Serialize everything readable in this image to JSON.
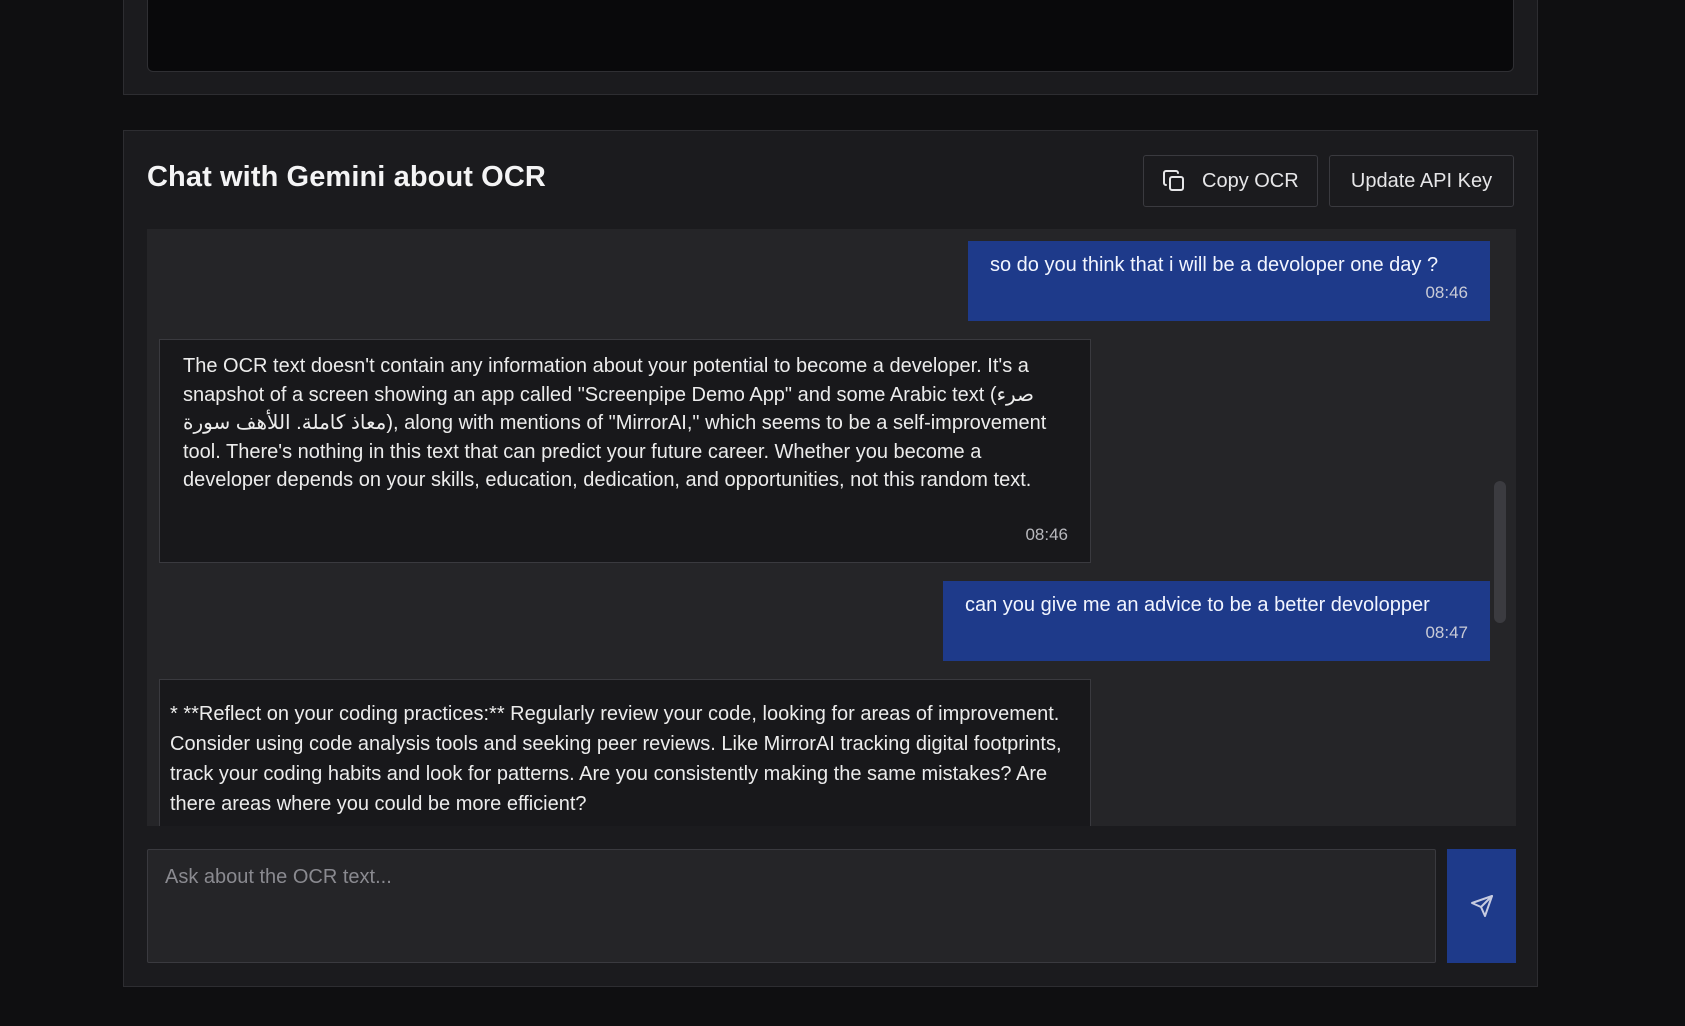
{
  "chat": {
    "title": "Chat with Gemini about OCR",
    "copy_ocr_label": "Copy OCR",
    "update_api_key_label": "Update API Key",
    "input_placeholder": "Ask about the OCR text...",
    "send_icon": "send-icon",
    "copy_icon": "copy-icon",
    "colors": {
      "user_bubble": "#1e3a8a",
      "background": "#0f0f11"
    },
    "messages": [
      {
        "role": "user",
        "text": "so do you think that i will be a devoloper one day ?",
        "time": "08:46"
      },
      {
        "role": "assistant",
        "text": "The OCR text doesn't contain any information about your potential to become a developer. It's a snapshot of a screen showing an app called \"Screenpipe Demo App\" and some Arabic text (صرء معاذ كاملة. اللأهف سورة), along with mentions of \"MirrorAI,\" which seems to be a self-improvement tool.  There's nothing in this text that can predict your future career.  Whether you become a developer depends on your skills, education, dedication, and opportunities, not this random text.",
        "time": "08:46"
      },
      {
        "role": "user",
        "text": "can you give me an advice to be a better devolopper",
        "time": "08:47"
      },
      {
        "role": "assistant",
        "text": "* **Reflect on your coding practices:** Regularly review your code, looking for areas of improvement. Consider using code analysis tools and seeking peer reviews.  Like MirrorAI tracking digital footprints, track your coding habits and look for patterns. Are you consistently making the same mistakes? Are there areas where you could be more efficient?"
      }
    ]
  }
}
